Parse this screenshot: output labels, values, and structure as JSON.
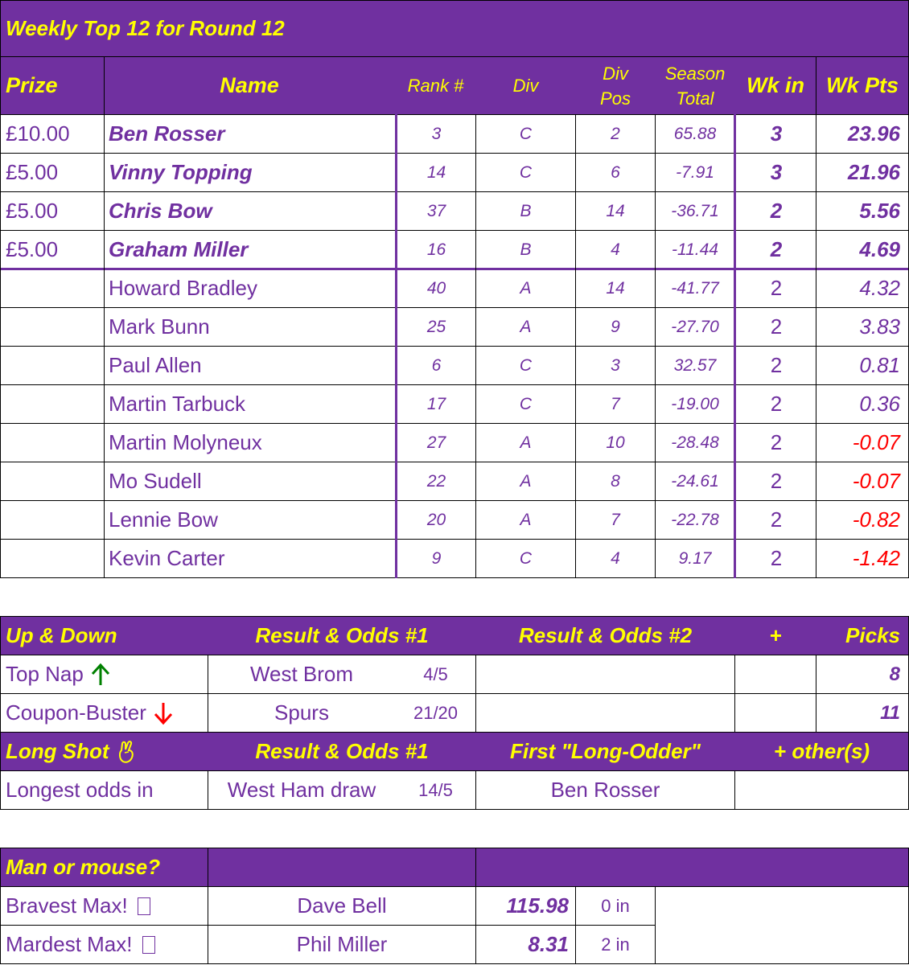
{
  "weekly": {
    "title": "Weekly Top 12 for Round 12",
    "headers": {
      "prize": "Prize",
      "name": "Name",
      "rank": "Rank #",
      "div": "Div",
      "div_pos_1": "Div",
      "div_pos_2": "Pos",
      "season_1": "Season",
      "season_2": "Total",
      "wk_in": "Wk in",
      "wk_pts": "Wk Pts"
    },
    "rows": [
      {
        "prize": "£10.00",
        "name": "Ben Rosser",
        "rank": "3",
        "div": "C",
        "div_pos": "2",
        "season": "65.88",
        "wk_in": "3",
        "wk_pts": "23.96"
      },
      {
        "prize": "£5.00",
        "name": "Vinny Topping",
        "rank": "14",
        "div": "C",
        "div_pos": "6",
        "season": "-7.91",
        "wk_in": "3",
        "wk_pts": "21.96"
      },
      {
        "prize": "£5.00",
        "name": "Chris Bow",
        "rank": "37",
        "div": "B",
        "div_pos": "14",
        "season": "-36.71",
        "wk_in": "2",
        "wk_pts": "5.56"
      },
      {
        "prize": "£5.00",
        "name": "Graham Miller",
        "rank": "16",
        "div": "B",
        "div_pos": "4",
        "season": "-11.44",
        "wk_in": "2",
        "wk_pts": "4.69"
      },
      {
        "prize": "",
        "name": "Howard Bradley",
        "rank": "40",
        "div": "A",
        "div_pos": "14",
        "season": "-41.77",
        "wk_in": "2",
        "wk_pts": "4.32"
      },
      {
        "prize": "",
        "name": "Mark Bunn",
        "rank": "25",
        "div": "A",
        "div_pos": "9",
        "season": "-27.70",
        "wk_in": "2",
        "wk_pts": "3.83"
      },
      {
        "prize": "",
        "name": "Paul Allen",
        "rank": "6",
        "div": "C",
        "div_pos": "3",
        "season": "32.57",
        "wk_in": "2",
        "wk_pts": "0.81"
      },
      {
        "prize": "",
        "name": "Martin Tarbuck",
        "rank": "17",
        "div": "C",
        "div_pos": "7",
        "season": "-19.00",
        "wk_in": "2",
        "wk_pts": "0.36"
      },
      {
        "prize": "",
        "name": "Martin Molyneux",
        "rank": "27",
        "div": "A",
        "div_pos": "10",
        "season": "-28.48",
        "wk_in": "2",
        "wk_pts": "-0.07"
      },
      {
        "prize": "",
        "name": "Mo Sudell",
        "rank": "22",
        "div": "A",
        "div_pos": "8",
        "season": "-24.61",
        "wk_in": "2",
        "wk_pts": "-0.07"
      },
      {
        "prize": "",
        "name": "Lennie Bow",
        "rank": "20",
        "div": "A",
        "div_pos": "7",
        "season": "-22.78",
        "wk_in": "2",
        "wk_pts": "-0.82"
      },
      {
        "prize": "",
        "name": "Kevin Carter",
        "rank": "9",
        "div": "C",
        "div_pos": "4",
        "season": "9.17",
        "wk_in": "2",
        "wk_pts": "-1.42"
      }
    ]
  },
  "updown": {
    "headers": {
      "title": "Up & Down",
      "result1": "Result & Odds #1",
      "result2": "Result & Odds #2",
      "plus": "+",
      "picks": "Picks"
    },
    "rows": [
      {
        "label": "Top Nap",
        "icon": "arrow-up-icon",
        "result": "West Brom",
        "odds": "4/5",
        "picks": "8"
      },
      {
        "label": "Coupon-Buster",
        "icon": "arrow-down-icon",
        "result": "Spurs",
        "odds": "21/20",
        "picks": "11"
      }
    ],
    "longshot_headers": {
      "title": "Long Shot",
      "icon": "crossed-fingers-icon",
      "result1": "Result & Odds #1",
      "first": "First \"Long-Odder\"",
      "others": "+ other(s)"
    },
    "longshot_row": {
      "label": "Longest odds in",
      "result": "West Ham draw",
      "odds": "14/5",
      "first": "Ben Rosser"
    }
  },
  "manmouse": {
    "title": "Man or mouse?",
    "rows": [
      {
        "label": "Bravest Max!",
        "icon": "emoji-placeholder-icon",
        "name": "Dave Bell",
        "value": "115.98",
        "wk_in": "0 in"
      },
      {
        "label": "Mardest Max!",
        "icon": "emoji-placeholder-icon",
        "name": "Phil Miller",
        "value": "8.31",
        "wk_in": "2 in"
      }
    ]
  },
  "colors": {
    "purple": "#7030a0",
    "yellow": "#ffff00",
    "negative": "#ff0000",
    "up": "#008000",
    "down": "#ff0000"
  }
}
